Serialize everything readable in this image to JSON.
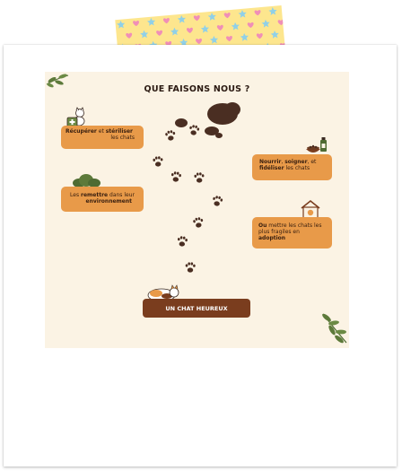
{
  "page": {
    "title": "QUE FAISONS NOUS ?",
    "colors": {
      "background": "#fbf3e4",
      "card": "#e89a49",
      "pill": "#7a3d1e",
      "paw": "#4a2e22",
      "leaf": "#5d7a3a",
      "tape": "#fde68a"
    }
  },
  "cards": {
    "recuperer": {
      "bold1": "Récupérer",
      "text1": " et ",
      "bold2": "stériliser",
      "text2": "les chats"
    },
    "remettre": {
      "text1": "Les ",
      "bold1": "remettre",
      "text2": " dans leur",
      "bold2": "environnement"
    },
    "nourrir": {
      "bold1": "Nourrir",
      "text1": ", ",
      "bold2": "soigner",
      "text2": ", et",
      "bold3": "fidéliser",
      "text3": " les chats"
    },
    "adoption": {
      "bold1": "Ou",
      "text1": " mettre les chats les plus fragiles en ",
      "bold2": "adoption"
    }
  },
  "footer": {
    "label": "UN CHAT HEUREUX"
  },
  "icons": [
    "cat-with-medical-case-icon",
    "bush-icon",
    "food-bowl-and-bottle-icon",
    "cat-house-icon",
    "sleeping-cat-icon",
    "paw-print-icon",
    "leaf-branch-icon",
    "tape-pattern"
  ]
}
